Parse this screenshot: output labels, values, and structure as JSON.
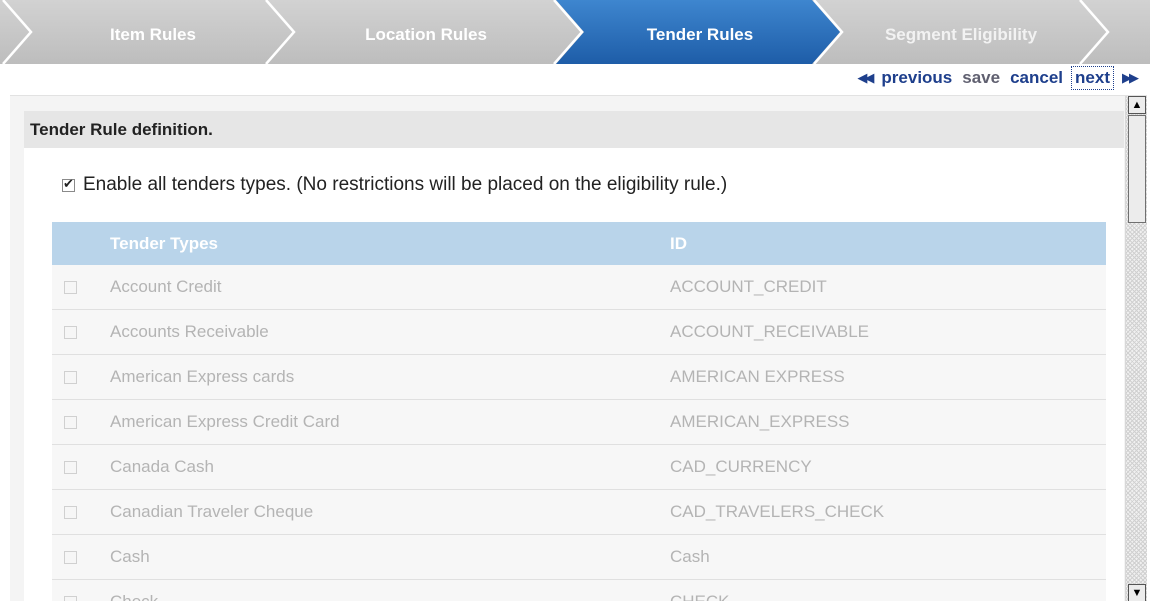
{
  "wizard": {
    "steps": [
      {
        "label": "Item Rules",
        "active": false
      },
      {
        "label": "Location Rules",
        "active": false
      },
      {
        "label": "Tender Rules",
        "active": true
      },
      {
        "label": "Segment Eligibility",
        "active": false
      }
    ]
  },
  "actions": {
    "prev_arrow": "◀◀",
    "previous": "previous",
    "save": "save",
    "cancel": "cancel",
    "next": "next",
    "next_arrow": "▶▶"
  },
  "section": {
    "title": "Tender Rule definition.",
    "enable_all": {
      "checked": true,
      "label": "Enable all tenders types. (No restrictions will be placed on the eligibility rule.)"
    }
  },
  "grid": {
    "columns": [
      "Tender Types",
      "ID"
    ],
    "rows": [
      {
        "name": "Account Credit",
        "id": "ACCOUNT_CREDIT"
      },
      {
        "name": "Accounts Receivable",
        "id": "ACCOUNT_RECEIVABLE"
      },
      {
        "name": "American Express cards",
        "id": "AMERICAN EXPRESS"
      },
      {
        "name": "American Express Credit Card",
        "id": "AMERICAN_EXPRESS"
      },
      {
        "name": "Canada Cash",
        "id": "CAD_CURRENCY"
      },
      {
        "name": "Canadian Traveler Cheque",
        "id": "CAD_TRAVELERS_CHECK"
      },
      {
        "name": "Cash",
        "id": "Cash"
      },
      {
        "name": "Check",
        "id": "CHECK"
      }
    ]
  },
  "colors": {
    "active_step": "#2a6bb6",
    "inactive_step": "#c4c4c4",
    "grid_header": "#b9d4ea",
    "link": "#1e3f8c"
  },
  "scrollbar": {
    "up_icon": "▲",
    "down_icon": "▼"
  }
}
